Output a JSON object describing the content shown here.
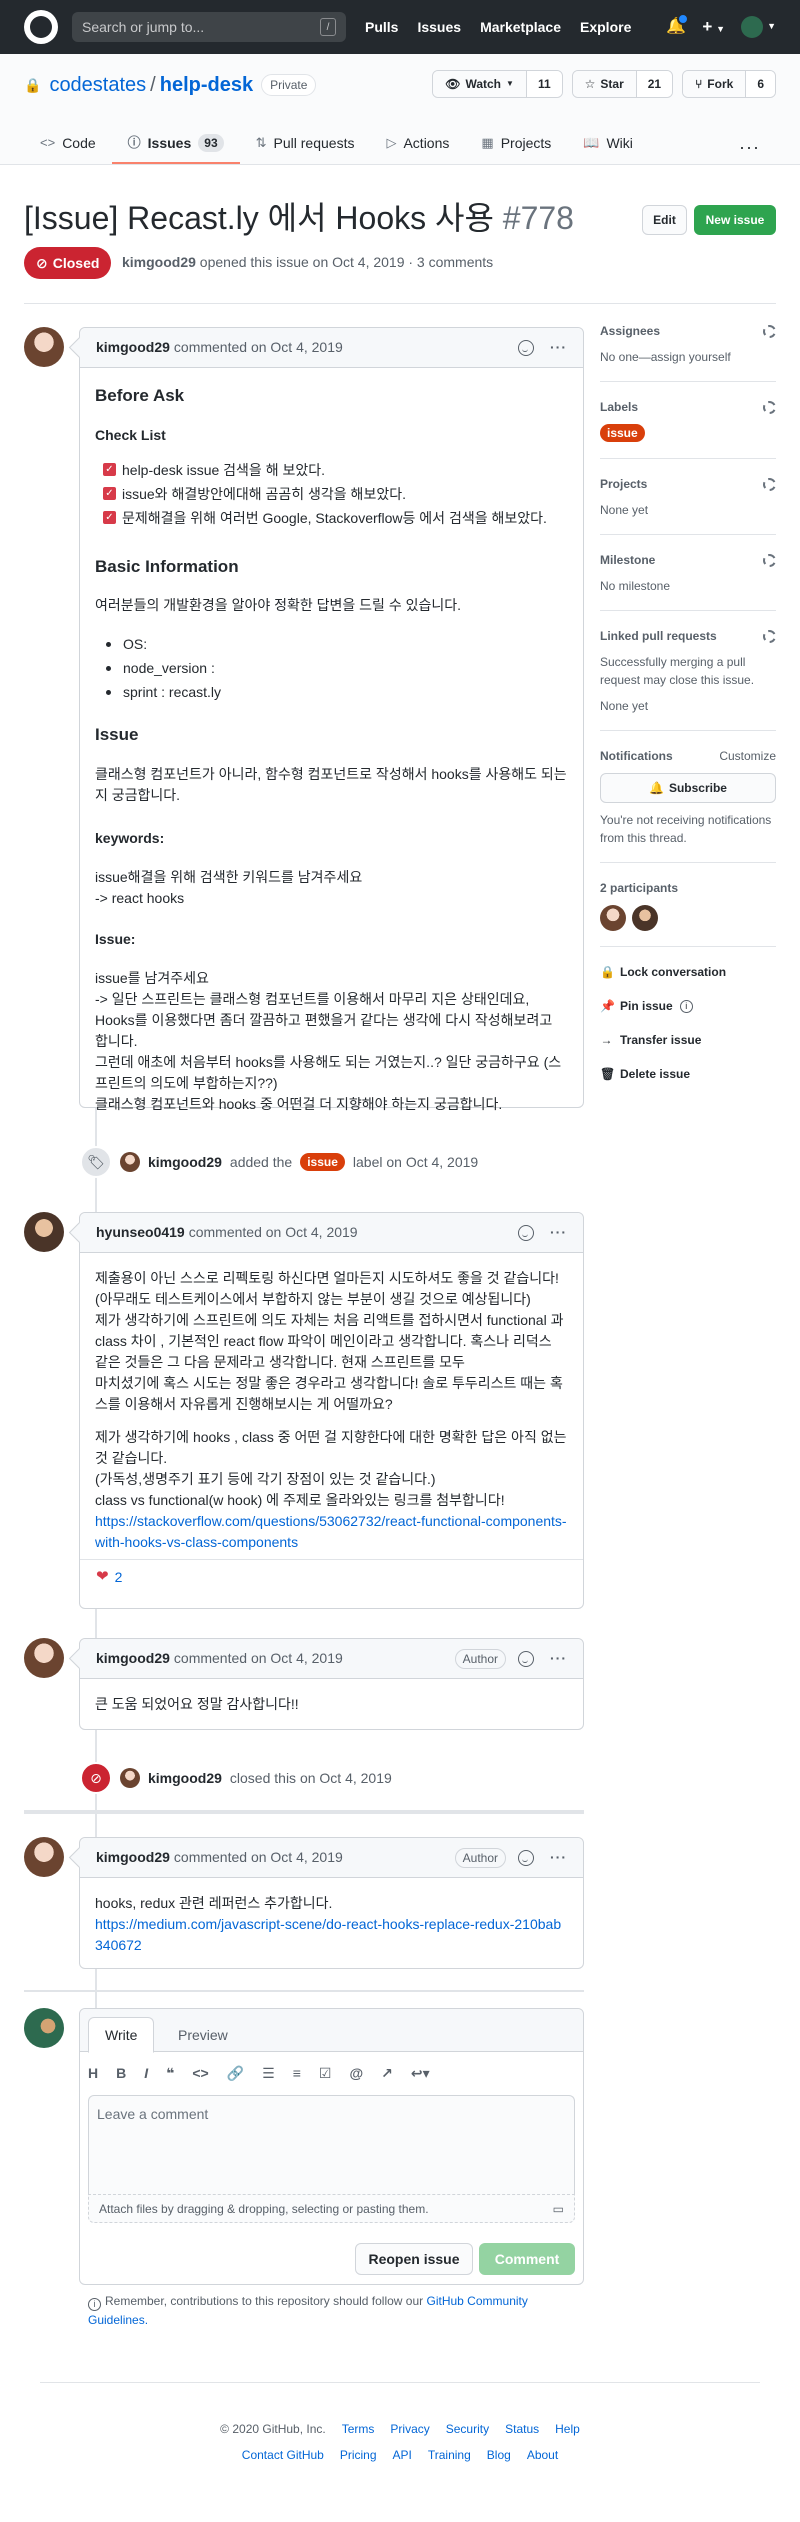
{
  "topbar": {
    "search_placeholder": "Search or jump to...",
    "search_key": "/",
    "nav": [
      "Pulls",
      "Issues",
      "Marketplace",
      "Explore"
    ]
  },
  "repo": {
    "owner": "codestates",
    "separator": "/",
    "name": "help-desk",
    "visibility": "Private",
    "watch_label": "Watch",
    "watch_count": "11",
    "star_label": "Star",
    "star_count": "21",
    "fork_label": "Fork",
    "fork_count": "6",
    "tabs": [
      {
        "label": "Code",
        "icon": "<>"
      },
      {
        "label": "Issues",
        "icon": "ⓘ",
        "count": "93"
      },
      {
        "label": "Pull requests",
        "icon": "⇅"
      },
      {
        "label": "Actions",
        "icon": "▷"
      },
      {
        "label": "Projects",
        "icon": "▦"
      },
      {
        "label": "Wiki",
        "icon": "📖"
      }
    ]
  },
  "issue": {
    "title": "[Issue] Recast.ly 에서 Hooks 사용",
    "number": "#778",
    "edit_label": "Edit",
    "new_issue_label": "New issue",
    "state": "Closed",
    "author": "kimgood29",
    "meta": "opened this issue on Oct 4, 2019 · 3 comments"
  },
  "comment1": {
    "author": "kimgood29",
    "meta": "commented on Oct 4, 2019",
    "h_before": "Before Ask",
    "h_checklist": "Check List",
    "checks": [
      "help-desk issue 검색을 해 보았다.",
      "issue와 해결방안에대해 곰곰히 생각을 해보았다.",
      "문제해결을 위해 여러번 Google, Stackoverflow등 에서 검색을 해보았다."
    ],
    "h_basic": "Basic Information",
    "basic_desc": "여러분들의 개발환경을 알아야 정확한 답변을 드릴 수 있습니다.",
    "env": [
      "OS:",
      "node_version :",
      "sprint : recast.ly"
    ],
    "h_issue": "Issue",
    "issue_desc": "클래스형 컴포넌트가 아니라, 함수형 컴포넌트로 작성해서 hooks를 사용해도 되는지 궁금합니다.",
    "h_keywords": "keywords:",
    "kw1": "issue해결을 위해 검색한 키워드를 남겨주세요",
    "kw2": "-> react hooks",
    "h_issue2": "Issue:",
    "i1": "issue를 남겨주세요",
    "i2": "-> 일단 스프린트는 클래스형 컴포넌트를 이용해서 마무리 지은 상태인데요,",
    "i3": "Hooks를 이용했다면 좀더 깔끔하고 편했을거 같다는 생각에 다시 작성해보려고 합니다.",
    "i4": "그런데 애초에 처음부터 hooks를 사용해도 되는 거였는지..? 일단 궁금하구요 (스프린트의 의도에 부합하는지??)",
    "i5": "클래스형 컴포넌트와 hooks 중 어떤걸 더 지향해야 하는지 궁금합니다."
  },
  "event_label": {
    "author": "kimgood29",
    "text": "added the",
    "label": "issue",
    "suffix": "label on Oct 4, 2019"
  },
  "comment2": {
    "author": "hyunseo0419",
    "meta": "commented on Oct 4, 2019",
    "p1": "제출용이 아닌 스스로 리펙토링 하신다면 얼마든지 시도하셔도 좋을 것 같습니다!",
    "p2": "(아무래도 테스트케이스에서 부합하지 않는 부분이 생길 것으로 예상됩니다)",
    "p3": "제가 생각하기에 스프린트에 의도 자체는 처음 리액트를 접하시면서 functional 과 class 차이 , 기본적인 react flow 파악이 메인이라고 생각합니다. 혹스나 리덕스 같은 것들은 그 다음 문제라고 생각합니다. 현재 스프린트를 모두",
    "p4": "마치셨기에 혹스 시도는 정말 좋은 경우라고 생각합니다! 솔로 투두리스트 때는 혹스를 이용해서 자유롭게 진행해보시는 게 어떨까요?",
    "p5": "제가 생각하기에 hooks , class 중 어떤 걸 지향한다에 대한 명확한 답은 아직 없는 것 같습니다.",
    "p6": "(가독성,생명주기 표기 등에 각기 장점이 있는 것 같습니다.)",
    "p7": "class vs functional(w hook) 에 주제로 올라와있는 링크를 첨부합니다!",
    "link": "https://stackoverflow.com/questions/53062732/react-functional-components-with-hooks-vs-class-components",
    "reaction_count": "2"
  },
  "comment3": {
    "author": "kimgood29",
    "meta": "commented on Oct 4, 2019",
    "role": "Author",
    "body": "큰 도움 되었어요 정말 감사합니다!!"
  },
  "event_closed": {
    "author": "kimgood29",
    "text": "closed this on Oct 4, 2019"
  },
  "comment4": {
    "author": "kimgood29",
    "meta": "commented on Oct 4, 2019",
    "role": "Author",
    "body": "hooks, redux 관련 레퍼런스 추가합니다.",
    "link": "https://medium.com/javascript-scene/do-react-hooks-replace-redux-210bab340672"
  },
  "new_comment": {
    "tab_write": "Write",
    "tab_preview": "Preview",
    "placeholder": "Leave a comment",
    "attach": "Attach files by dragging & dropping, selecting or pasting them.",
    "reopen_label": "Reopen issue",
    "comment_label": "Comment",
    "remember": "Remember, contributions to this repository should follow our",
    "guidelines": "GitHub Community Guidelines."
  },
  "sidebar": {
    "assignees_t": "Assignees",
    "assignees_v": "No one—assign yourself",
    "labels_t": "Labels",
    "label": "issue",
    "projects_t": "Projects",
    "projects_v": "None yet",
    "milestone_t": "Milestone",
    "milestone_v": "No milestone",
    "linked_t": "Linked pull requests",
    "linked_v": "Successfully merging a pull request may close this issue.",
    "linked_v2": "None yet",
    "notif_t": "Notifications",
    "customize": "Customize",
    "subscribe": "Subscribe",
    "notif_v": "You're not receiving notifications from this thread.",
    "participants_t": "2 participants",
    "lock": "Lock conversation",
    "pin": "Pin issue",
    "transfer": "Transfer issue",
    "delete": "Delete issue"
  },
  "footer": {
    "copyright": "© 2020 GitHub, Inc.",
    "links1": [
      "Terms",
      "Privacy",
      "Security",
      "Status",
      "Help"
    ],
    "links2": [
      "Contact GitHub",
      "Pricing",
      "API",
      "Training",
      "Blog",
      "About"
    ]
  },
  "colors": {
    "closed_red": "#cb2431",
    "label_orange": "#d93f0b",
    "green": "#2ea44f",
    "link_blue": "#0366d6"
  }
}
